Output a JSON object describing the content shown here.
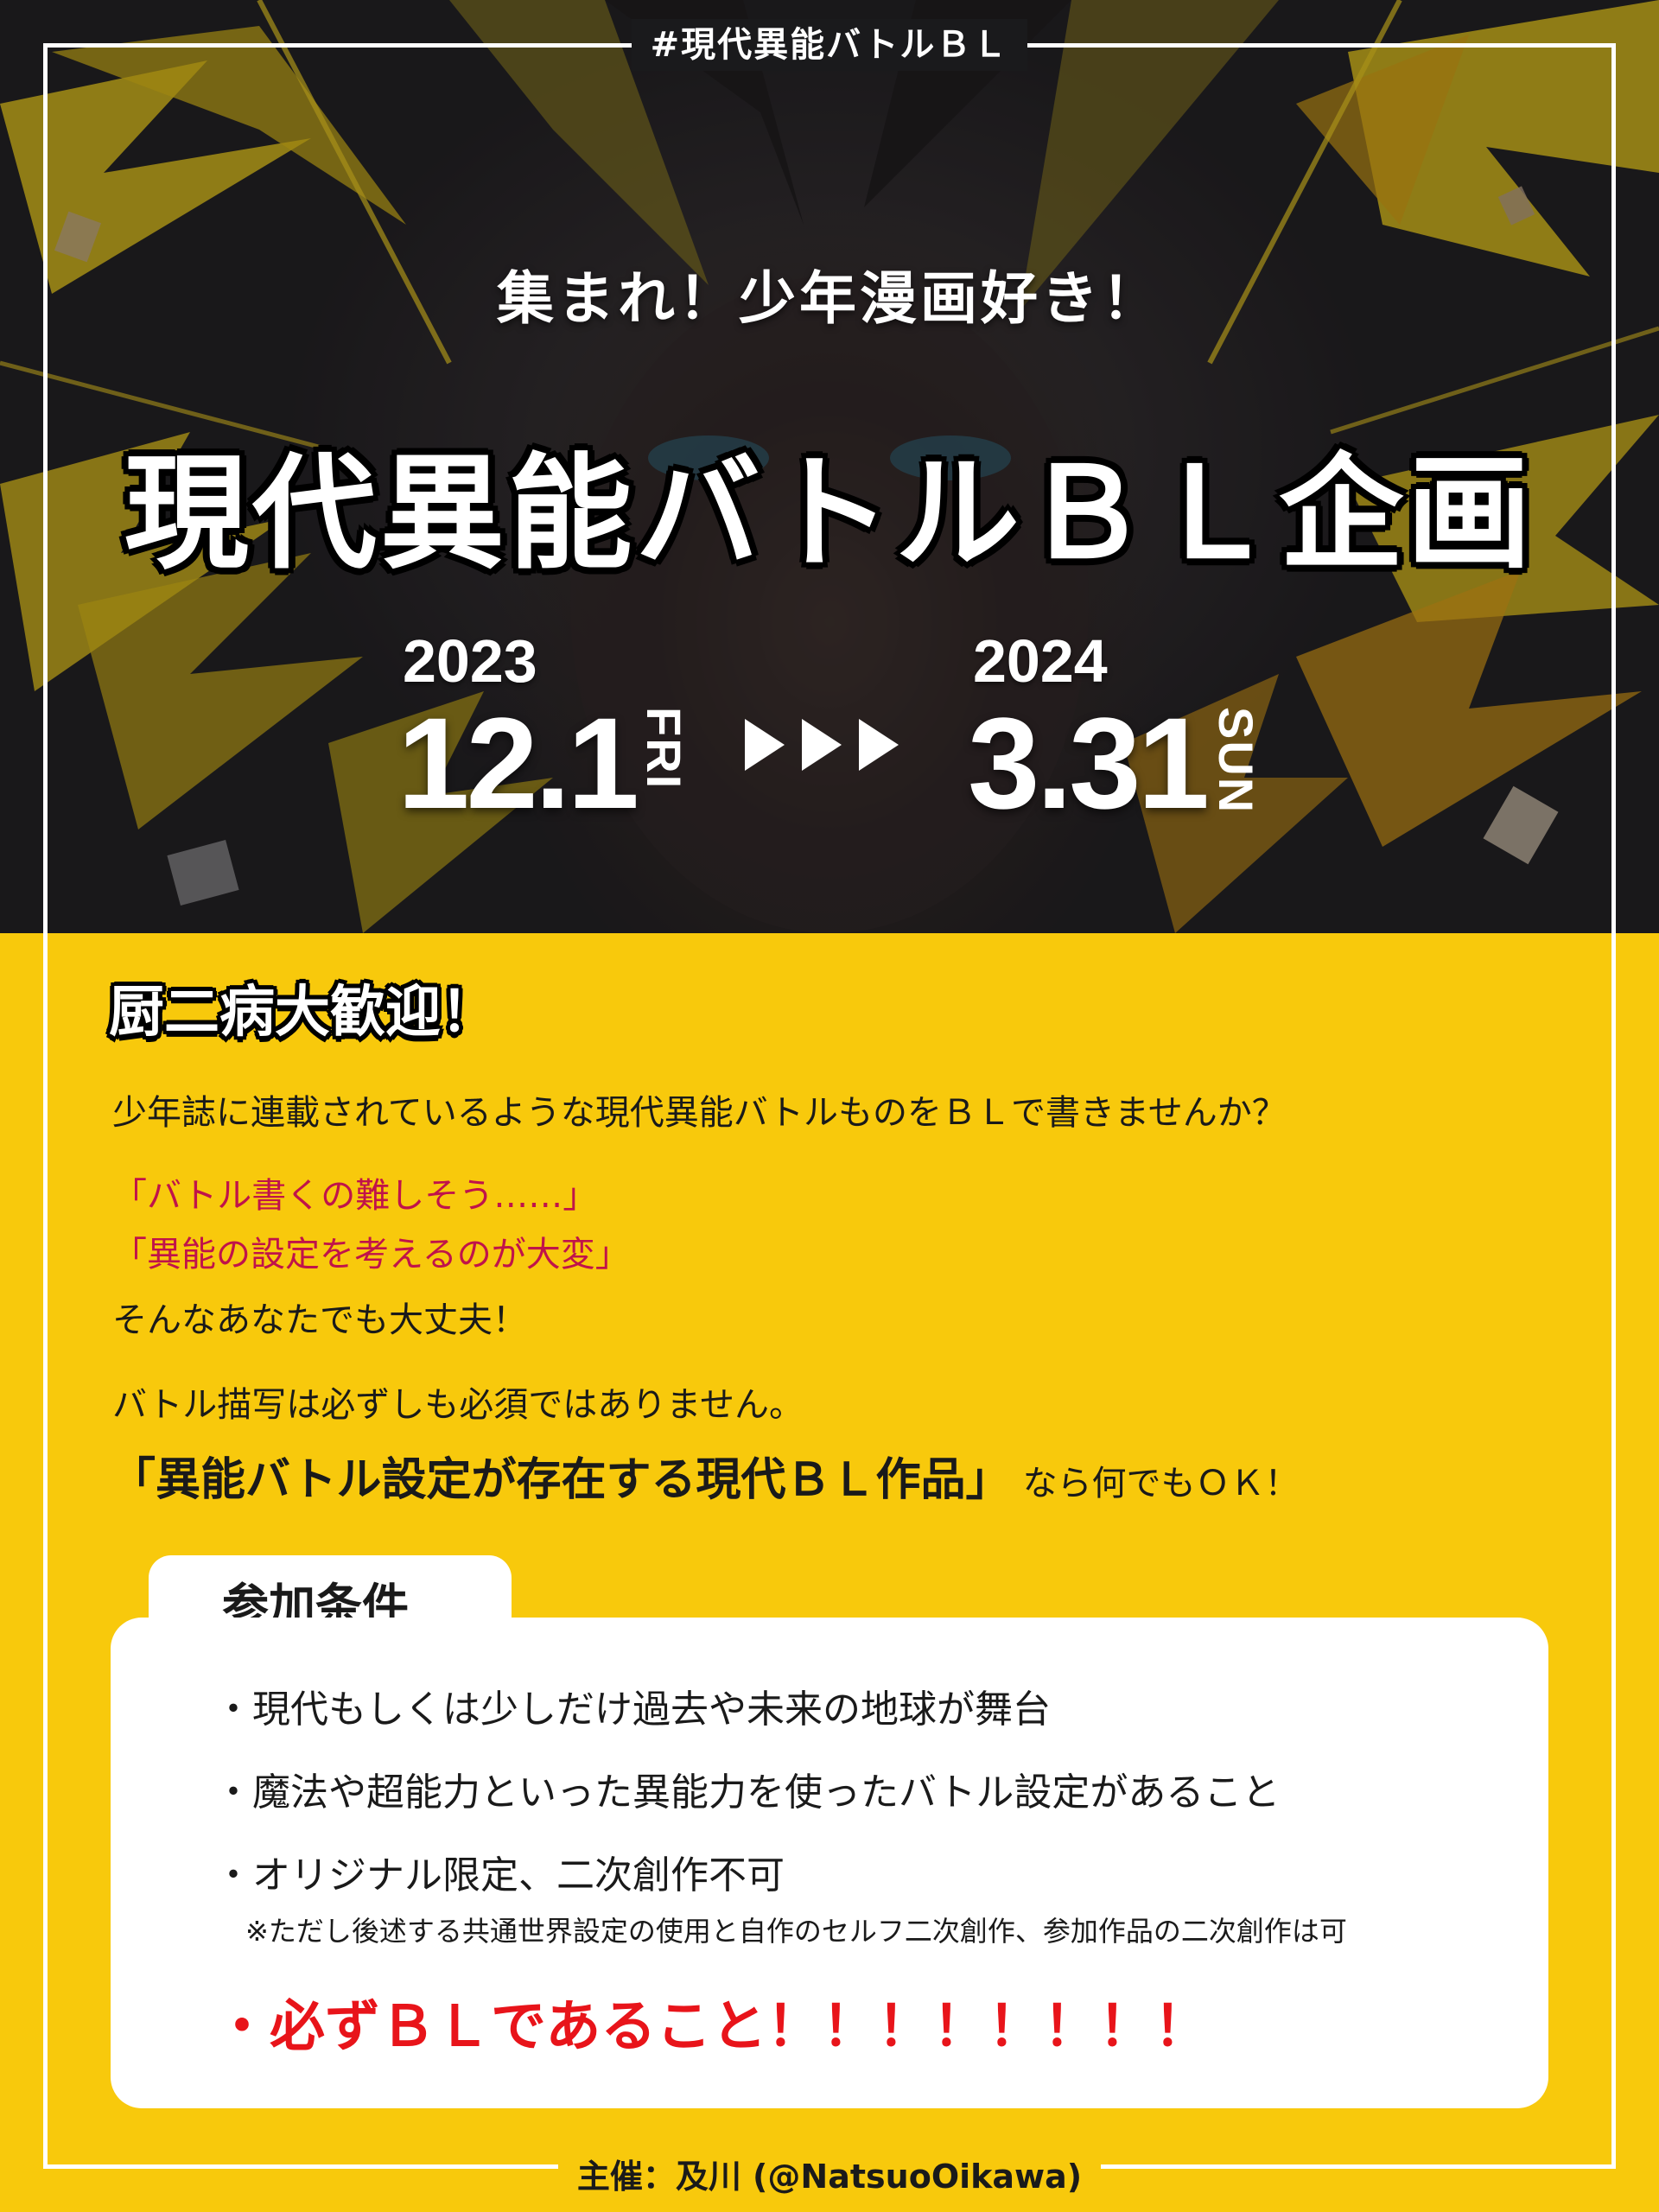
{
  "hashtag": "#現代異能バトルＢＬ",
  "catchcopy": "集まれ！少年漫画好き！",
  "title": "現代異能バトルＢＬ企画",
  "period": {
    "start": {
      "year": "2023",
      "date": "12.1",
      "day": "FRI"
    },
    "end": {
      "year": "2024",
      "date": "3.31",
      "day": "SUN"
    }
  },
  "welcome": "厨二病大歓迎！",
  "intro": "少年誌に連載されているような現代異能バトルものをＢＬで書きませんか？",
  "quote1": "「バトル書くの難しそう……」",
  "quote2": "「異能の設定を考えるのが大変」",
  "reassure": "そんなあなたでも大丈夫！",
  "note": "バトル描写は必ずしも必須ではありません。",
  "emphasis": "「異能バトル設定が存在する現代ＢＬ作品」",
  "emphasis_tail": "なら何でもＯＫ！",
  "conditions": {
    "heading": "参加条件",
    "items": [
      "・現代もしくは少しだけ過去や未来の地球が舞台",
      "・魔法や超能力といった異能力を使ったバトル設定があること",
      "・オリジナル限定、二次創作不可"
    ],
    "footnote": "※ただし後述する共通世界設定の使用と自作のセルフ二次創作、参加作品の二次創作は可",
    "must": "・必ずＢＬであること！！！！！！！！"
  },
  "host": "主催：及川 (@NatsuoOikawa)",
  "colors": {
    "yellow": "#f8c90c",
    "red": "#e8141a",
    "quote": "#c0134a"
  }
}
